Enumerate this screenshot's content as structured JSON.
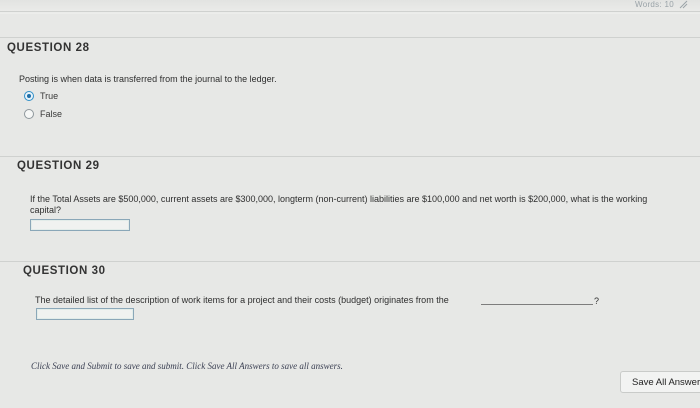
{
  "header": {
    "words_badge": "Words: 10"
  },
  "questions": [
    {
      "title": "QUESTION 28",
      "text": "Posting is when data is transferred from the journal to the ledger.",
      "options": [
        {
          "label": "True",
          "selected": true
        },
        {
          "label": "False",
          "selected": false
        }
      ]
    },
    {
      "title": "QUESTION 29",
      "text": "If the Total Assets are $500,000, current assets are $300,000, longterm (non-current) liabilities are $100,000 and net worth is $200,000, what is the working capital?",
      "answer_value": ""
    },
    {
      "title": "QUESTION 30",
      "text": "The detailed list of the description of work items for a project and their costs (budget) originates from the",
      "suffix": "?",
      "answer_value": ""
    }
  ],
  "footer": {
    "instructions": "Click Save and Submit to save and submit. Click Save All Answers to save all answers.",
    "save_all_label": "Save All Answers"
  },
  "colors": {
    "page_background": "#e7e8e6",
    "radio_selected": "#1f6fa8",
    "footer_text": "#3a3f52"
  }
}
